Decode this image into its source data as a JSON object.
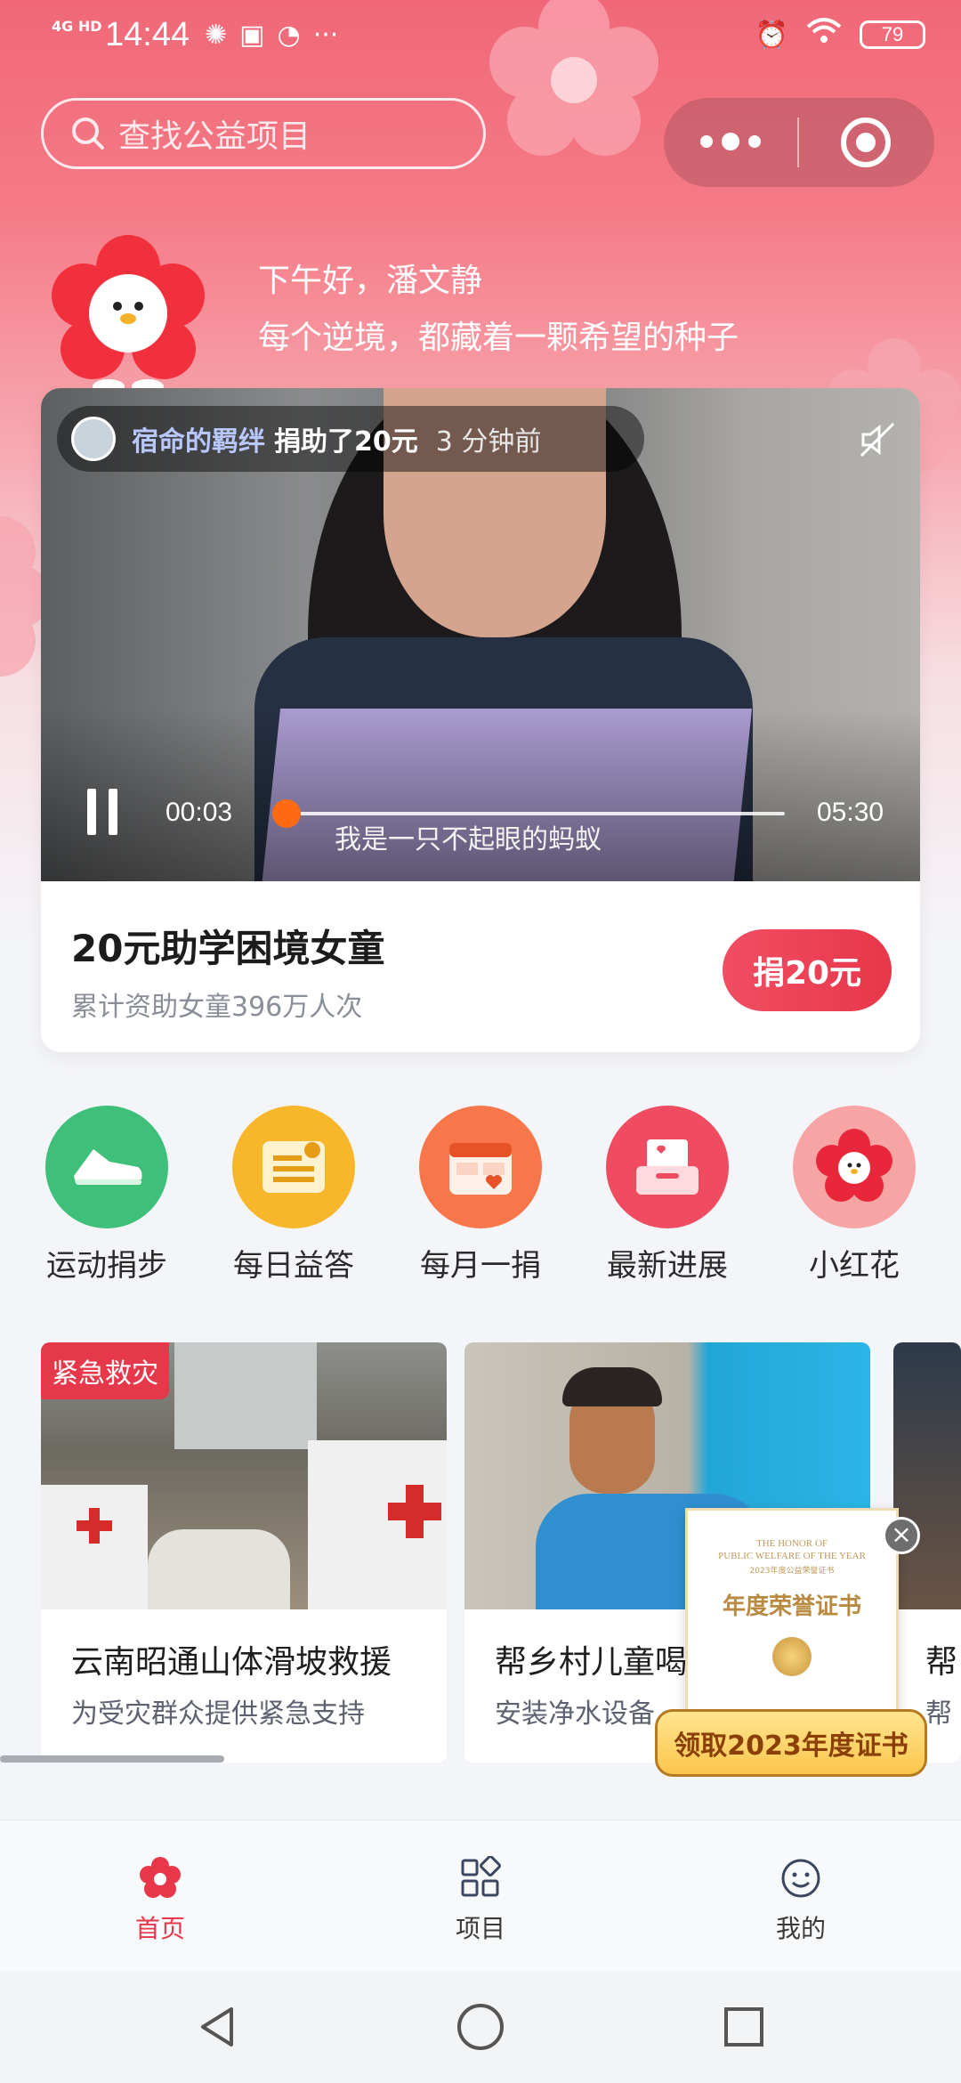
{
  "status_bar": {
    "network": "4G HD",
    "time": "14:44",
    "more": "···",
    "battery": "79"
  },
  "search": {
    "placeholder": "查找公益项目"
  },
  "greeting": {
    "line1": "下午好，潘文静",
    "line2": "每个逆境，都藏着一颗希望的种子"
  },
  "featured": {
    "donor_name": "宿命的羁绊",
    "donor_action": "捐助了20元",
    "donor_time": "3 分钟前",
    "current_time": "00:03",
    "total_time": "05:30",
    "progress": 0.01,
    "subtitle": "我是一只不起眼的蚂蚁",
    "title": "20元助学困境女童",
    "summary": "累计资助女童396万人次",
    "donate_label": "捐20元"
  },
  "entries": [
    {
      "label": "运动捐步",
      "icon": "sneaker-icon",
      "color": "#3fc07a"
    },
    {
      "label": "每日益答",
      "icon": "quiz-icon",
      "color": "#f8b62a"
    },
    {
      "label": "每月一捐",
      "icon": "calendar-icon",
      "color": "#f7774a"
    },
    {
      "label": "最新进展",
      "icon": "inbox-icon",
      "color": "#ef4c62"
    },
    {
      "label": "小红花",
      "icon": "red-flower-icon",
      "color": "#f7a4a4"
    }
  ],
  "projects": [
    {
      "tag": "紧急救灾",
      "title": "云南昭通山体滑坡救援",
      "subtitle": "为受灾群众提供紧急支持"
    },
    {
      "title": "帮乡村儿童喝",
      "subtitle": "安装净水设备",
      "tag": ""
    },
    {
      "title": "帮",
      "subtitle": "帮",
      "tag": ""
    }
  ],
  "certificate": {
    "en_line1": "THE HONOR OF",
    "en_line2": "PUBLIC WELFARE OF THE YEAR",
    "small": "2023年度公益荣誉证书",
    "title": "年度荣誉证书",
    "button": "领取2023年度证书"
  },
  "tabs": [
    {
      "label": "首页",
      "icon": "flower-icon",
      "active": true
    },
    {
      "label": "项目",
      "icon": "grid-icon",
      "active": false
    },
    {
      "label": "我的",
      "icon": "smile-icon",
      "active": false
    }
  ],
  "colors": {
    "brand": "#e8364a",
    "accent_orange": "#ff6a13"
  }
}
